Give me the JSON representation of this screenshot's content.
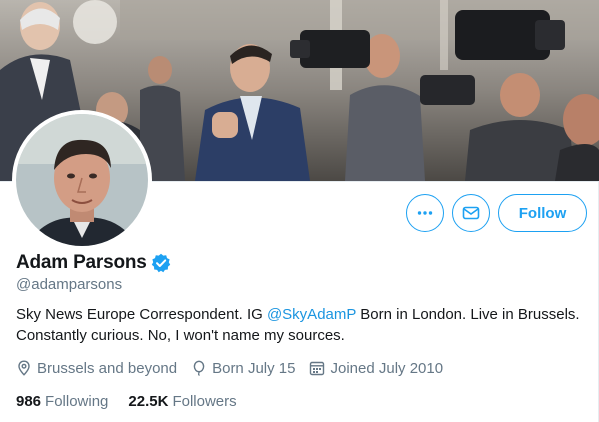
{
  "profile": {
    "display_name": "Adam Parsons",
    "handle": "@adamparsons",
    "verified": true,
    "bio": {
      "text_before": "Sky News Europe Correspondent. IG ",
      "link": "@SkyAdamP",
      "text_after": " Born in London. Live in Brussels. Constantly curious. No, I won't name my sources."
    },
    "location": "Brussels and beyond",
    "birthday": "Born July 15",
    "joined": "Joined July 2010"
  },
  "stats": {
    "following_count": "986",
    "following_label": "Following",
    "followers_count": "22.5K",
    "followers_label": "Followers"
  },
  "actions": {
    "follow_label": "Follow",
    "more_icon": "more-icon",
    "message_icon": "envelope-icon"
  },
  "colors": {
    "accent": "#1da1f2",
    "link": "#1b95e0",
    "secondary_text": "#657786",
    "primary_text": "#14171a"
  }
}
